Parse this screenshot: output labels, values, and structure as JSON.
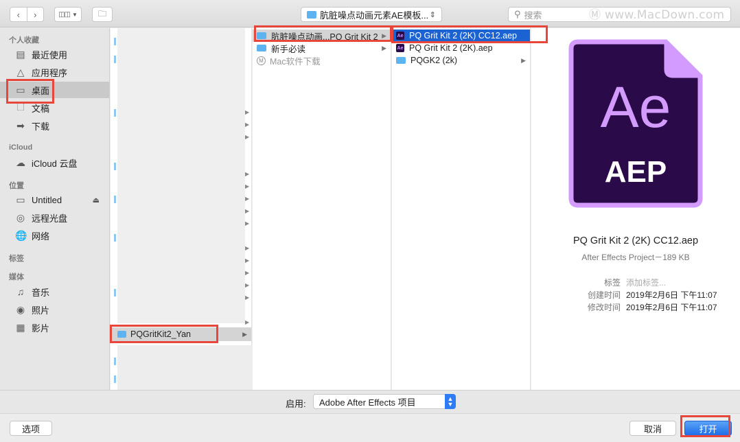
{
  "toolbar": {
    "back_icon": "chevron-left-icon",
    "forward_icon": "chevron-right-icon",
    "path_label": "肮脏噪点动画元素AE模板...",
    "search_placeholder": "搜索",
    "watermark": "www.MacDown.com"
  },
  "sidebar": {
    "favorites_header": "个人收藏",
    "favorites": [
      {
        "label": "最近使用",
        "icon": "recents-icon"
      },
      {
        "label": "应用程序",
        "icon": "applications-icon"
      },
      {
        "label": "桌面",
        "icon": "desktop-icon",
        "selected": true
      },
      {
        "label": "文稿",
        "icon": "documents-icon"
      },
      {
        "label": "下载",
        "icon": "downloads-icon"
      }
    ],
    "icloud_header": "iCloud",
    "icloud": [
      {
        "label": "iCloud 云盘",
        "icon": "cloud-icon"
      }
    ],
    "locations_header": "位置",
    "locations": [
      {
        "label": "Untitled",
        "icon": "disk-icon"
      },
      {
        "label": "远程光盘",
        "icon": "disc-icon"
      },
      {
        "label": "网络",
        "icon": "network-icon"
      }
    ],
    "tags_header": "标签",
    "media_header": "媒体",
    "media": [
      {
        "label": "音乐",
        "icon": "music-icon"
      },
      {
        "label": "照片",
        "icon": "camera-icon"
      },
      {
        "label": "影片",
        "icon": "film-icon"
      }
    ]
  },
  "columns": {
    "col1_selected": "PQGritKit2_Yan",
    "col2": [
      {
        "label": "肮脏噪点动画...PQ Grit Kit 2",
        "type": "folder",
        "state": "gray"
      },
      {
        "label": "新手必读",
        "type": "folder"
      },
      {
        "label": "Mac软件下载",
        "type": "link",
        "dim": true
      }
    ],
    "col3": [
      {
        "label": "PQ Grit Kit 2 (2K) CC12.aep",
        "type": "aep",
        "state": "blue"
      },
      {
        "label": "PQ Grit Kit 2 (2K).aep",
        "type": "aep"
      },
      {
        "label": "PQGK2 (2k)",
        "type": "folder"
      }
    ]
  },
  "preview": {
    "icon_text_top": "Ae",
    "icon_text_bottom": "AEP",
    "file_name": "PQ Grit Kit 2 (2K) CC12.aep",
    "kind": "After Effects Project－189 KB",
    "tags_key": "标签",
    "tags_value": "添加标签...",
    "created_key": "创建时间",
    "created_value": "2019年2月6日 下午11:07",
    "modified_key": "修改时间",
    "modified_value": "2019年2月6日 下午11:07"
  },
  "enable": {
    "label": "启用:",
    "value": "Adobe After Effects 项目"
  },
  "buttons": {
    "options": "选项",
    "cancel": "取消",
    "open": "打开"
  },
  "colors": {
    "highlight": "#e8463a",
    "selection_blue": "#1b63d2",
    "ae_purple": "#2b0a4a",
    "ae_text": "#d49bff"
  }
}
